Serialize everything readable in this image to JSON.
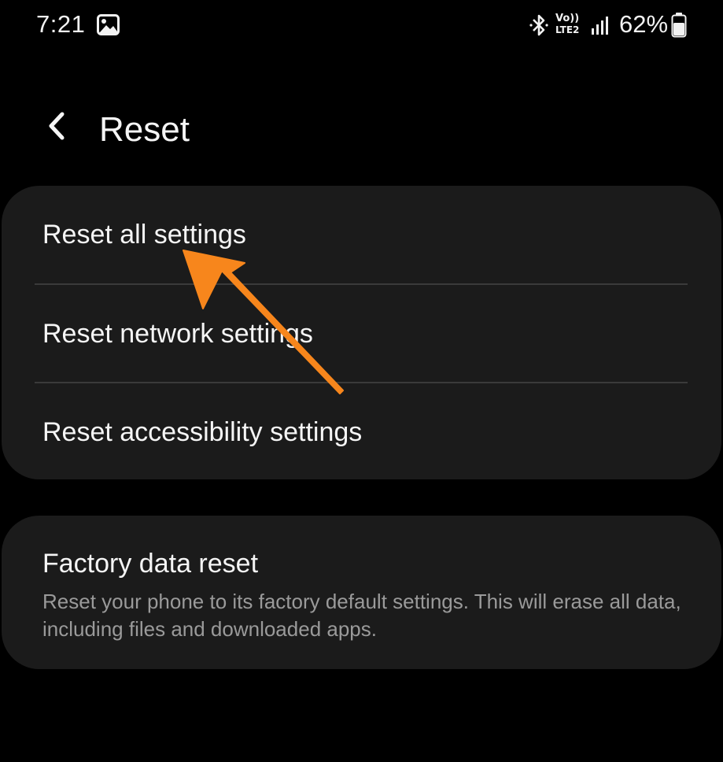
{
  "status_bar": {
    "time": "7:21",
    "network_line1": "Vo))",
    "network_line2": "LTE2",
    "battery": "62%"
  },
  "header": {
    "title": "Reset"
  },
  "reset_card": {
    "items": [
      {
        "label": "Reset all settings"
      },
      {
        "label": "Reset network settings"
      },
      {
        "label": "Reset accessibility settings"
      }
    ]
  },
  "factory_card": {
    "title": "Factory data reset",
    "description": "Reset your phone to its factory default settings. This will erase all data, including files and downloaded apps."
  },
  "colors": {
    "background": "#000000",
    "card": "#1b1b1b",
    "divider": "#3a3a3a",
    "primary_text": "#f5f5f5",
    "secondary_text": "#9a9a9a",
    "annotation_arrow": "#f7861c"
  },
  "icons": {
    "gallery": "gallery-icon",
    "bluetooth": "bluetooth-icon",
    "signal": "signal-icon",
    "battery": "battery-icon",
    "back": "chevron-left-icon",
    "annotation": "arrow-annotation-icon"
  }
}
